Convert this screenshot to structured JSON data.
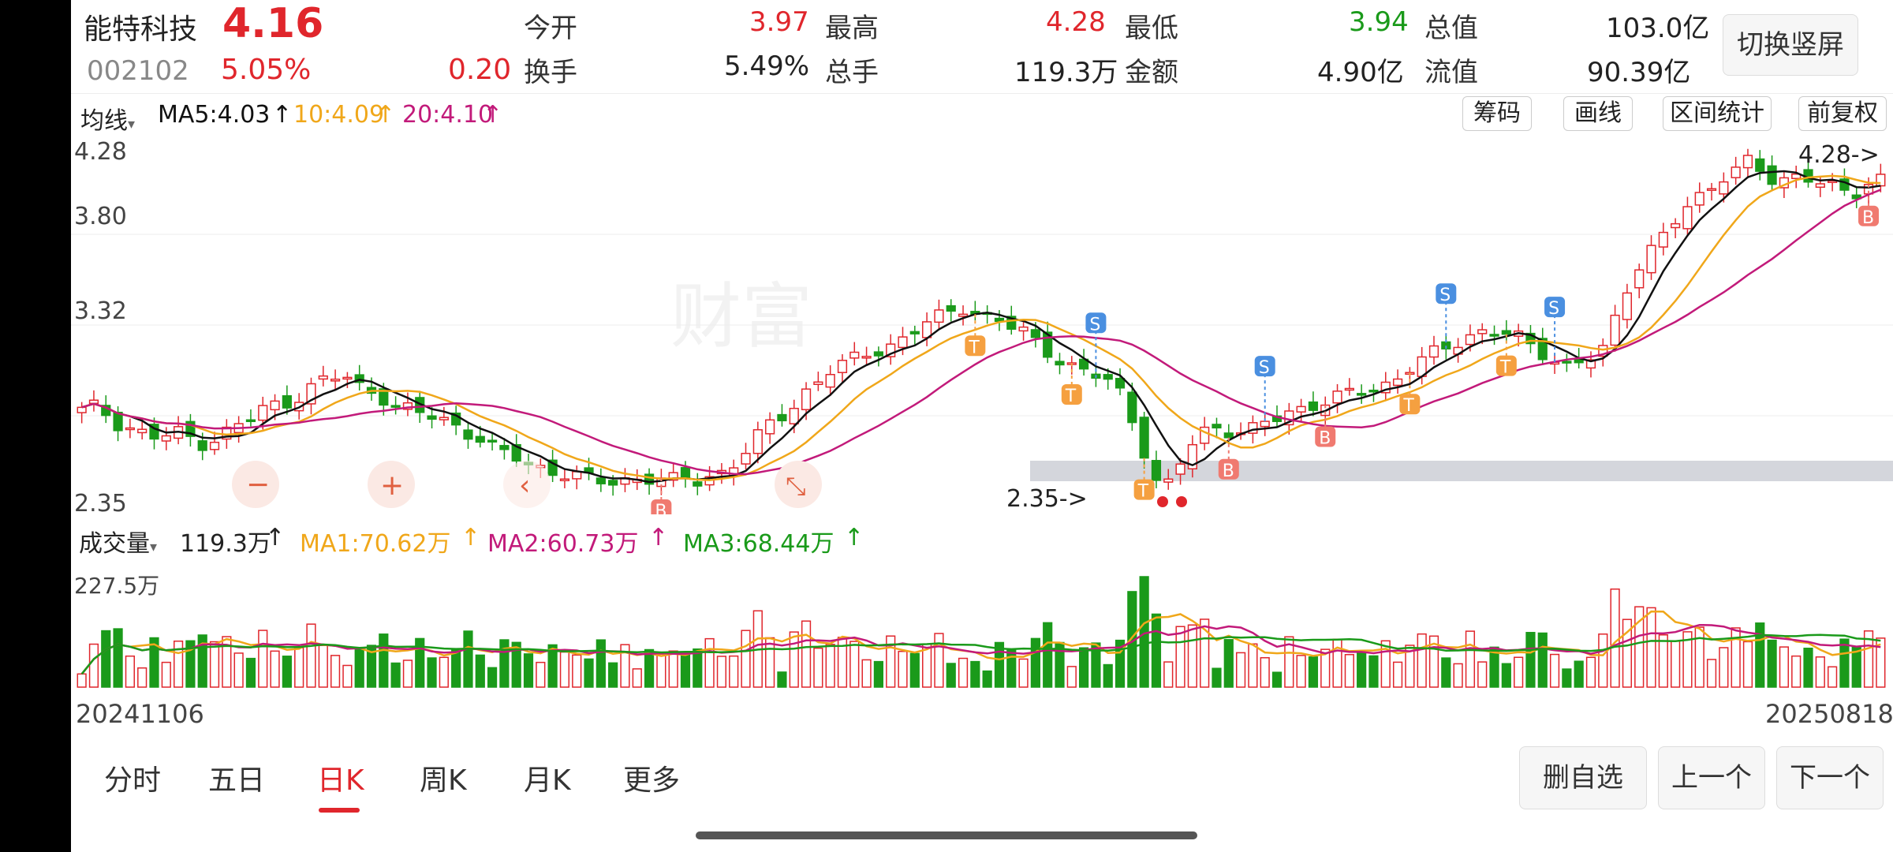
{
  "stock": {
    "name": "能特科技",
    "price": "4.16",
    "code": "002102",
    "change_pct": "5.05%",
    "change": "0.20"
  },
  "quote": {
    "open_label": "今开",
    "open": "3.97",
    "high_label": "最高",
    "high": "4.28",
    "low_label": "最低",
    "low": "3.94",
    "mktcap_label": "总值",
    "mktcap": "103.0亿",
    "turnover_label": "换手",
    "turnover": "5.49%",
    "volume_label": "总手",
    "volume": "119.3万",
    "amount_label": "金额",
    "amount": "4.90亿",
    "float_label": "流值",
    "float": "90.39亿"
  },
  "header": {
    "switch_label": "切换竖屏"
  },
  "ma": {
    "selector": "均线",
    "ma5": "MA5:4.03",
    "ma10": "10:4.09",
    "ma20": "20:4.10",
    "arrow": "↑"
  },
  "tools": [
    "筹码",
    "画线",
    "区间统计",
    "前复权"
  ],
  "price_axis": [
    "4.28",
    "3.80",
    "3.32",
    "2.35"
  ],
  "annotations": {
    "high_marker": "4.28->",
    "low_marker": "2.35->",
    "watermark": "财富"
  },
  "markers": {
    "buy": "B",
    "sell": "S",
    "trade": "T"
  },
  "zoom": {
    "minus": "−",
    "plus": "+",
    "left": "‹",
    "collapse": "⤡"
  },
  "volume": {
    "selector": "成交量",
    "current": "119.3万",
    "ma1": "MA1:70.62万",
    "ma2": "MA2:60.73万",
    "ma3": "MA3:68.44万",
    "axis_max": "227.5万"
  },
  "dates": {
    "start": "20241106",
    "end": "20250818"
  },
  "tabs": [
    "分时",
    "五日",
    "日K",
    "周K",
    "月K",
    "更多"
  ],
  "active_tab": "日K",
  "bottom_buttons": {
    "remove": "删自选",
    "prev": "上一个",
    "next": "下一个"
  },
  "colors": {
    "up": "#e0262c",
    "down": "#1a9a1a",
    "ma5": "#111111",
    "ma10": "#f0a71a",
    "ma20": "#c21a7a",
    "low_label": "#1a9a1a"
  },
  "chart_data": {
    "type": "candlestick",
    "x": "trading days",
    "xrange": [
      "20241106",
      "20250818"
    ],
    "ylim": [
      2.3,
      4.35
    ],
    "close_profile": [
      2.84,
      2.86,
      2.82,
      2.76,
      2.74,
      2.7,
      2.68,
      2.72,
      2.7,
      2.66,
      2.68,
      2.72,
      2.76,
      2.8,
      2.86,
      2.88,
      2.9,
      2.95,
      3.0,
      3.02,
      3.04,
      2.98,
      2.96,
      2.92,
      2.86,
      2.84,
      2.82,
      2.8,
      2.78,
      2.74,
      2.7,
      2.64,
      2.6,
      2.58,
      2.54,
      2.52,
      2.5,
      2.48,
      2.46,
      2.44,
      2.44,
      2.45,
      2.46,
      2.46,
      2.45,
      2.44,
      2.46,
      2.45,
      2.48,
      2.5,
      2.56,
      2.64,
      2.74,
      2.8,
      2.86,
      2.94,
      3.0,
      3.06,
      3.1,
      3.14,
      3.18,
      3.2,
      3.22,
      3.26,
      3.32,
      3.36,
      3.4,
      3.44,
      3.4,
      3.36,
      3.34,
      3.3,
      3.28,
      3.22,
      3.16,
      3.1,
      3.06,
      3.04,
      3.02,
      2.96,
      2.8,
      2.6,
      2.4,
      2.42,
      2.6,
      2.7,
      2.76,
      2.74,
      2.72,
      2.72,
      2.76,
      2.8,
      2.84,
      2.86,
      2.88,
      2.9,
      2.92,
      2.94,
      2.96,
      2.98,
      3.02,
      3.08,
      3.12,
      3.16,
      3.2,
      3.24,
      3.28,
      3.3,
      3.28,
      3.26,
      3.22,
      3.18,
      3.14,
      3.1,
      3.12,
      3.14,
      3.18,
      3.4,
      3.6,
      3.72,
      3.8,
      3.88,
      3.96,
      4.02,
      4.1,
      4.18,
      4.22,
      4.26,
      4.18,
      4.1,
      4.14,
      4.2,
      4.16,
      4.12,
      4.08,
      4.04,
      4.1,
      4.16
    ],
    "ma5_last": 4.03,
    "ma10_last": 4.09,
    "ma20_last": 4.1
  }
}
